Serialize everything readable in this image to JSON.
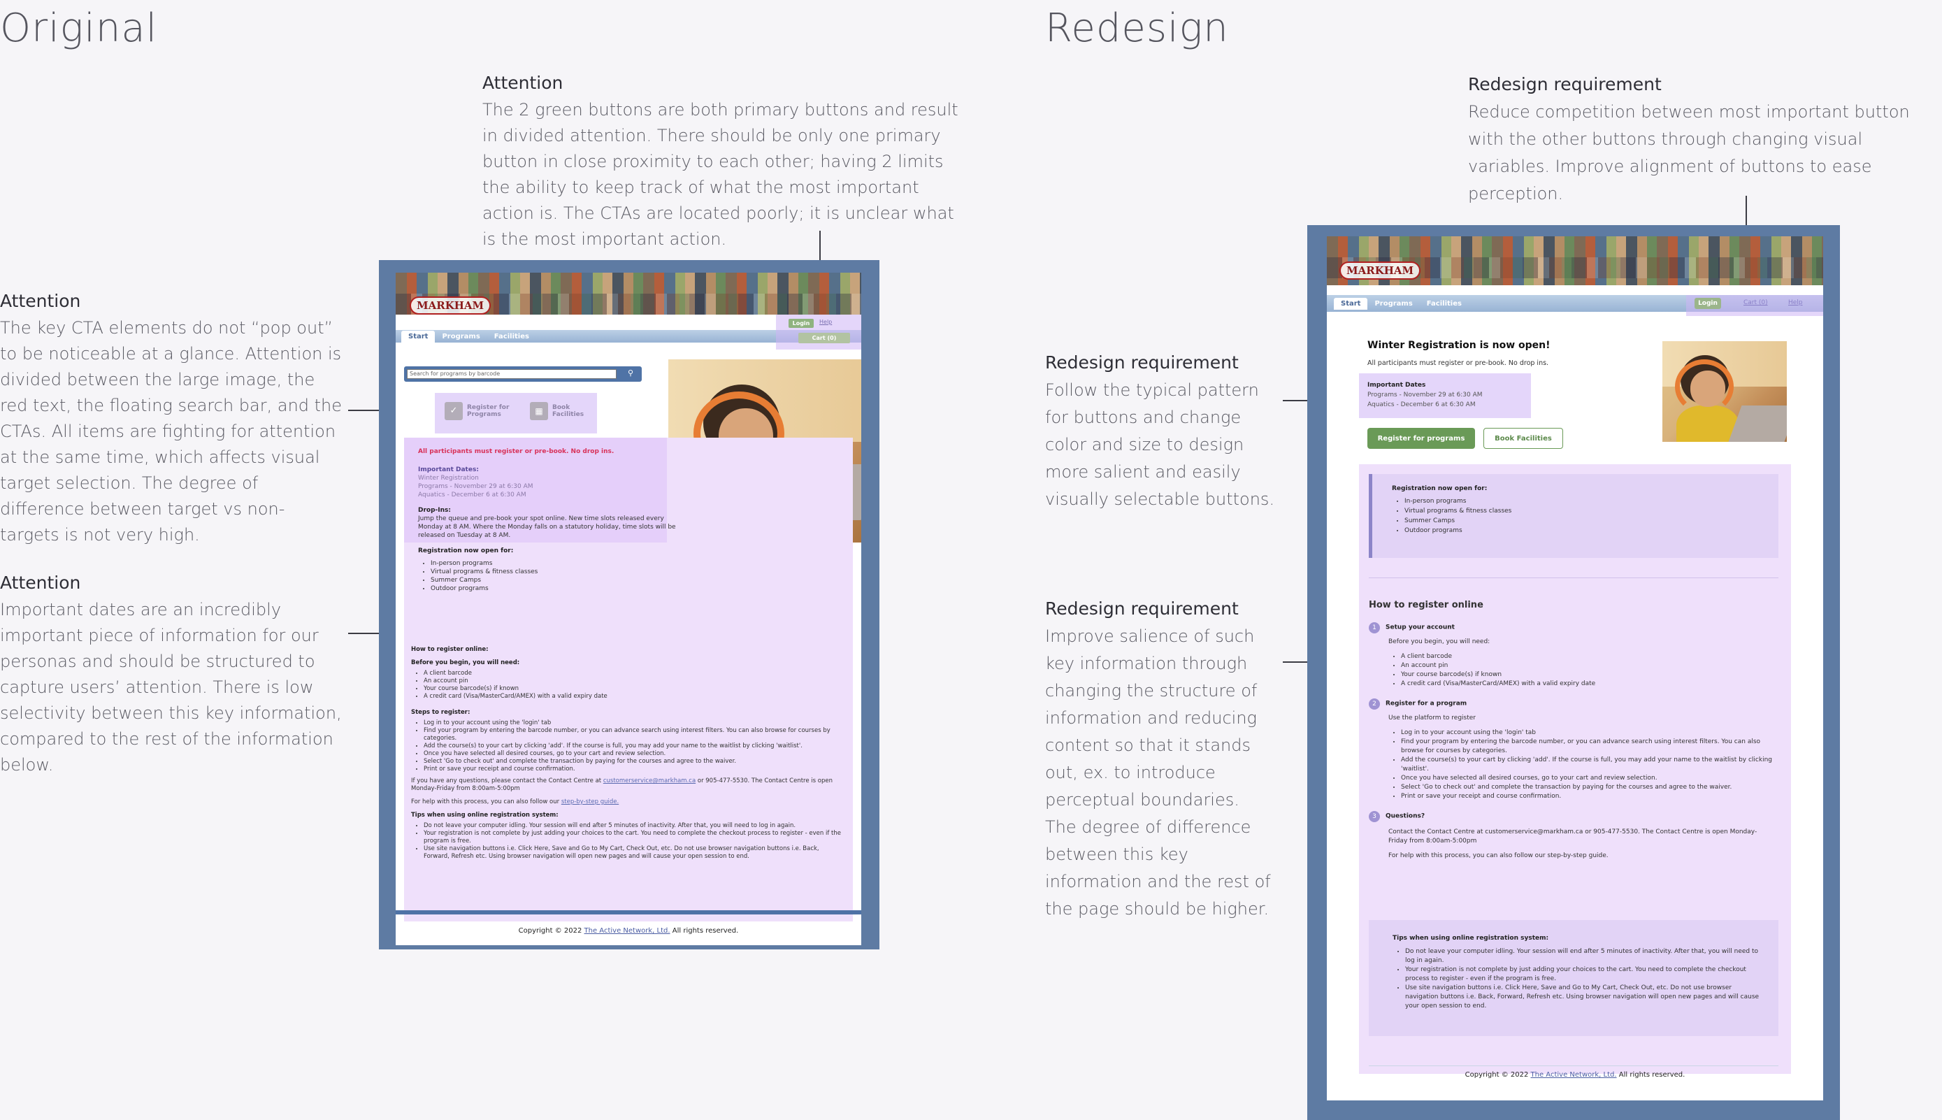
{
  "headings": {
    "original": "Original",
    "redesign": "Redesign"
  },
  "annotations": {
    "orig_top": {
      "title": "Attention",
      "body": "The 2 green buttons are both primary buttons and result in divided attention. There should be only one primary button in close proximity to each other; having 2 limits the ability to keep track of what the most important action is. The CTAs are located poorly; it is unclear what is the most important action."
    },
    "orig_mid": {
      "title": "Attention",
      "body": "The key CTA elements do not “pop out” to be noticeable at a glance. Attention is divided between the large image, the red text, the floating search bar, and the CTAs. All items are fighting for attention at the same time, which affects visual target selection. The degree of difference between target vs non-targets is not very high."
    },
    "orig_low": {
      "title": "Attention",
      "body": "Important dates are an incredibly important piece of information for our personas and should be structured to capture users’ attention. There is low selectivity between this key information, compared to the rest of the information below."
    },
    "red_top": {
      "title": "Redesign requirement",
      "body": "Reduce competition between most important button with the other buttons through changing visual variables. Improve alignment of buttons to ease perception."
    },
    "red_mid": {
      "title": "Redesign requirement",
      "body": "Follow the typical pattern for buttons and change color and size to design more salient and easily visually selectable buttons."
    },
    "red_low": {
      "title": "Redesign requirement",
      "body": "Improve salience of such key information through changing the structure of information and reducing content so that it stands out, ex. to introduce perceptual boundaries. The degree of difference between this key information and the rest of the page should be higher."
    }
  },
  "original_page": {
    "logo": "MARKHAM",
    "tabs": [
      "Start",
      "Programs",
      "Facilities"
    ],
    "login": "Login",
    "help": "Help",
    "cart": "Cart (0)",
    "search_placeholder": "Search for programs by barcode",
    "register_btn": "Register for Programs",
    "book_btn": "Book Facilities",
    "alert": "All participants must register or pre-book. No drop ins.",
    "important_dates_title": "Important Dates:",
    "important_dates": [
      "Winter Registration",
      "Programs - November 29 at 6:30 AM",
      "Aquatics - December 6 at 6:30 AM"
    ],
    "dropins_title": "Drop-Ins:",
    "dropins_body": "Jump the queue and pre-book your spot online. New time slots released every Monday at 8 AM. Where the Monday falls on a statutory holiday, time slots will be released on Tuesday at 8 AM.",
    "open_title": "Registration now open for:",
    "open_items": [
      "In-person programs",
      "Virtual programs & fitness classes",
      "Summer Camps",
      "Outdoor programs"
    ],
    "how_title": "How to register online:",
    "before_title": "Before you begin, you will need:",
    "before_items": [
      "A client barcode",
      "An account pin",
      "Your course barcode(s) if known",
      "A credit card (Visa/MasterCard/AMEX) with a valid expiry date"
    ],
    "steps_title": "Steps to register:",
    "steps_items": [
      "Log in to your account using the 'login' tab",
      "Find your program by entering the barcode number, or you can advance search using interest filters. You can also browse for courses by categories.",
      "Add the course(s) to your cart by clicking 'add'. If the course is full, you may add your name to the waitlist by clicking 'waitlist'.",
      "Once you have selected all desired courses, go to your cart and review selection.",
      "Select 'Go to check out' and complete the transaction by paying for the courses and agree to the waiver.",
      "Print or save your receipt and course confirmation."
    ],
    "questions_pre": "If you have any questions, please contact the Contact Centre at",
    "questions_email": "customerservice@markham.ca",
    "questions_post": "or 905-477-5530. The Contact Centre is open Monday-Friday from 8:00am-5:00pm",
    "help_pre": "For help with this process, you can also follow our",
    "help_link": "step-by-step guide.",
    "tips_title": "Tips when using online registration system:",
    "tips_items": [
      "Do not leave your computer idling. Your session will end after 5 minutes of inactivity. After that, you will need to log in again.",
      "Your registration is not complete by just adding your choices to the cart. You need to complete the checkout process to register - even if the program is free.",
      "Use site navigation buttons i.e. Click Here, Save and Go to My Cart, Check Out, etc. Do not use browser navigation buttons i.e. Back, Forward, Refresh etc. Using browser navigation will open new pages and will cause your open session to end."
    ],
    "footer_pre": "Copyright © 2022",
    "footer_link": "The Active Network, Ltd.",
    "footer_post": "All rights reserved."
  },
  "redesign_page": {
    "logo": "MARKHAM",
    "tabs": [
      "Start",
      "Programs",
      "Facilities"
    ],
    "login": "Login",
    "cart": "Cart (0)",
    "help": "Help",
    "title": "Winter Registration is now open!",
    "subtitle": "All participants must register or pre-book. No drop ins.",
    "dates_title": "Important Dates",
    "dates": [
      "Programs - November 29 at 6:30 AM",
      "Aquatics - December 6 at 6:30 AM"
    ],
    "primary_btn": "Register for programs",
    "secondary_btn": "Book Facilities",
    "open_title": "Registration now open for:",
    "open_items": [
      "In-person programs",
      "Virtual programs & fitness classes",
      "Summer Camps",
      "Outdoor programs"
    ],
    "how_title": "How to register online",
    "step1_title": "Setup your account",
    "step1_intro": "Before you begin, you will need:",
    "step1_items": [
      "A client barcode",
      "An account pin",
      "Your course barcode(s) if known",
      "A credit card (Visa/MasterCard/AMEX) with a valid expiry date"
    ],
    "step2_title": "Register for a program",
    "step2_intro": "Use the platform to register",
    "step2_items": [
      "Log in to your account using the 'login' tab",
      "Find your program by entering the barcode number, or you can advance search using interest filters. You can also browse for courses by categories.",
      "Add the course(s) to your cart by clicking 'add'. If the course is full, you may add your name to the waitlist by clicking 'waitlist'.",
      "Once you have selected all desired courses, go to your cart and review selection.",
      "Select 'Go to check out' and complete the transaction by paying for the courses and agree to the waiver.",
      "Print or save your receipt and course confirmation."
    ],
    "step3_title": "Questions?",
    "step3_body": "Contact the Contact Centre at customerservice@markham.ca or 905-477-5530. The Contact Centre is open Monday-Friday from 8:00am-5:00pm",
    "step3_help": "For help with this process, you can also follow our step-by-step guide.",
    "tips_title": "Tips when using online registration system:",
    "tips_items": [
      "Do not leave your computer idling. Your session will end after 5 minutes of inactivity. After that, you will need to log in again.",
      "Your registration is not complete by just adding your choices to the cart. You need to complete the checkout process to register - even if the program is free.",
      "Use site navigation buttons i.e. Click Here, Save and Go to My Cart, Check Out, etc. Do not use browser navigation buttons i.e. Back, Forward, Refresh etc. Using browser navigation will open new pages and will cause your open session to end."
    ],
    "footer_pre": "Copyright © 2022",
    "footer_link": "The Active Network, Ltd.",
    "footer_post": "All rights reserved."
  }
}
